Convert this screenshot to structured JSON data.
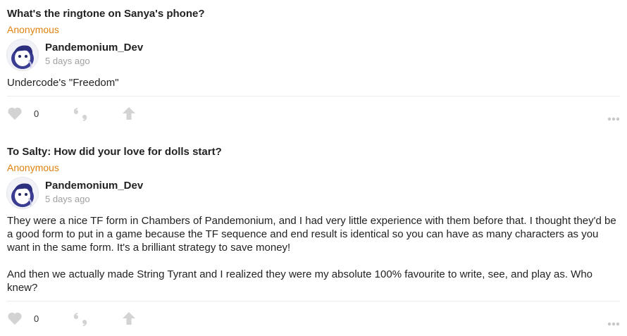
{
  "posts": [
    {
      "question": "What's the ringtone on Sanya's phone?",
      "asker": "Anonymous",
      "author": "Pandemonium_Dev",
      "time": "5 days ago",
      "answer": [
        "Undercode's \"Freedom\""
      ],
      "likes": "0"
    },
    {
      "question": "To Salty: How did your love for dolls start?",
      "asker": "Anonymous",
      "author": "Pandemonium_Dev",
      "time": "5 days ago",
      "answer": [
        "They were a nice TF form in Chambers of Pandemonium, and I had very little experience with them before that. I thought they'd be a good form to put in a game because the TF sequence and end result is identical so you can have as many characters as you want in the same form. It's a brilliant strategy to save money!",
        "And then we actually made String Tyrant and I realized they were my absolute 100% favourite to write, see, and play as. Who knew?"
      ],
      "likes": "0"
    }
  ],
  "icons": {
    "like": "heart-icon",
    "quote": "quote-icon",
    "share": "arrow-up-icon",
    "more": "more-dots-icon"
  },
  "colors": {
    "asker": "#e0820f",
    "icon": "#d3d3d3",
    "timestamp": "#a0a0a0"
  }
}
